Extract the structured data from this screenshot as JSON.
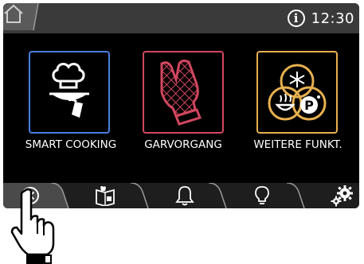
{
  "status_bar": {
    "time": "12:30",
    "info_symbol": "i",
    "home_icon": "home-icon"
  },
  "tiles": [
    {
      "label": "SMART COOKING",
      "icon": "chef-hat-cloche-icon",
      "border_color": "#4a7ede"
    },
    {
      "label": "GARVORGANG",
      "icon": "oven-mitt-icon",
      "border_color": "#d2475f"
    },
    {
      "label": "WEITERE FUNKT.",
      "icon": "more-functions-icon",
      "border_color": "#e7b04e"
    }
  ],
  "bottom_bar": {
    "buttons": [
      {
        "icon": "cancel-circle-icon"
      },
      {
        "icon": "recipe-book-icon"
      },
      {
        "icon": "bell-icon"
      },
      {
        "icon": "lightbulb-icon"
      },
      {
        "icon": "settings-gears-icon"
      }
    ]
  },
  "overlay": {
    "pointer": "hand-pointer-icon"
  }
}
